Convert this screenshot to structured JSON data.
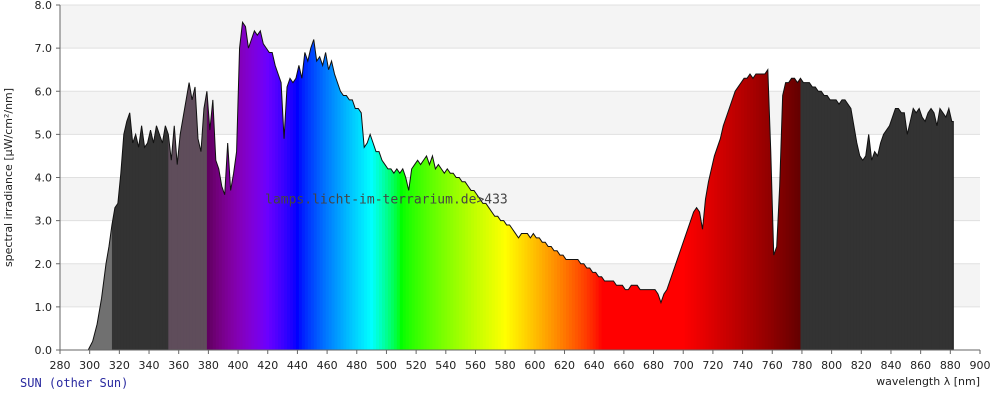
{
  "footer": {
    "lamp_label": "SUN (other Sun)"
  },
  "chart_data": {
    "type": "area",
    "title": "",
    "watermark": "lamps.licht-im-terrarium.de>433",
    "xlabel": "wavelength λ [nm]",
    "ylabel": "spectral irradiance [µW/cm²/nm]",
    "xlim": [
      280,
      900
    ],
    "ylim": [
      0,
      8
    ],
    "xticks": [
      280,
      300,
      320,
      340,
      360,
      380,
      400,
      420,
      440,
      460,
      480,
      500,
      520,
      540,
      560,
      580,
      600,
      620,
      640,
      660,
      680,
      700,
      720,
      740,
      760,
      780,
      800,
      820,
      840,
      860,
      880,
      900
    ],
    "yticks": [
      0,
      1,
      2,
      3,
      4,
      5,
      6,
      7,
      8
    ],
    "ytick_labels": [
      "0.0",
      "1.0",
      "2.0",
      "3.0",
      "4.0",
      "5.0",
      "6.0",
      "7.0",
      "8.0"
    ],
    "grid": "horizontal-bands",
    "points": [
      [
        299,
        0
      ],
      [
        302,
        0.2
      ],
      [
        305,
        0.6
      ],
      [
        308,
        1.2
      ],
      [
        311,
        2.0
      ],
      [
        313,
        2.4
      ],
      [
        315,
        2.9
      ],
      [
        317,
        3.3
      ],
      [
        319,
        3.4
      ],
      [
        321,
        4.1
      ],
      [
        323,
        5.0
      ],
      [
        325,
        5.3
      ],
      [
        327,
        5.5
      ],
      [
        329,
        4.8
      ],
      [
        331,
        5.0
      ],
      [
        333,
        4.7
      ],
      [
        335,
        5.2
      ],
      [
        337,
        4.7
      ],
      [
        339,
        4.8
      ],
      [
        341,
        5.1
      ],
      [
        343,
        4.8
      ],
      [
        345,
        5.2
      ],
      [
        347,
        5.0
      ],
      [
        349,
        4.8
      ],
      [
        351,
        5.2
      ],
      [
        353,
        5.0
      ],
      [
        355,
        4.4
      ],
      [
        357,
        5.2
      ],
      [
        359,
        4.3
      ],
      [
        361,
        5.0
      ],
      [
        363,
        5.4
      ],
      [
        365,
        5.8
      ],
      [
        367,
        6.2
      ],
      [
        369,
        5.8
      ],
      [
        371,
        6.1
      ],
      [
        373,
        4.9
      ],
      [
        375,
        4.6
      ],
      [
        377,
        5.6
      ],
      [
        379,
        6.0
      ],
      [
        381,
        5.1
      ],
      [
        383,
        5.8
      ],
      [
        385,
        4.4
      ],
      [
        387,
        4.2
      ],
      [
        389,
        3.8
      ],
      [
        391,
        3.6
      ],
      [
        393,
        4.8
      ],
      [
        395,
        3.7
      ],
      [
        397,
        4.1
      ],
      [
        399,
        4.6
      ],
      [
        401,
        7.0
      ],
      [
        403,
        7.6
      ],
      [
        405,
        7.5
      ],
      [
        407,
        7.0
      ],
      [
        409,
        7.2
      ],
      [
        411,
        7.4
      ],
      [
        413,
        7.3
      ],
      [
        415,
        7.4
      ],
      [
        417,
        7.1
      ],
      [
        419,
        7.0
      ],
      [
        421,
        6.9
      ],
      [
        423,
        6.9
      ],
      [
        425,
        6.6
      ],
      [
        427,
        6.4
      ],
      [
        429,
        6.2
      ],
      [
        431,
        4.9
      ],
      [
        433,
        6.1
      ],
      [
        435,
        6.3
      ],
      [
        437,
        6.2
      ],
      [
        439,
        6.3
      ],
      [
        441,
        6.6
      ],
      [
        443,
        6.3
      ],
      [
        445,
        6.9
      ],
      [
        447,
        6.7
      ],
      [
        449,
        7.0
      ],
      [
        451,
        7.2
      ],
      [
        453,
        6.7
      ],
      [
        455,
        6.8
      ],
      [
        457,
        6.6
      ],
      [
        459,
        6.9
      ],
      [
        461,
        6.5
      ],
      [
        463,
        6.7
      ],
      [
        465,
        6.4
      ],
      [
        467,
        6.2
      ],
      [
        469,
        6.0
      ],
      [
        471,
        5.9
      ],
      [
        473,
        5.9
      ],
      [
        475,
        5.8
      ],
      [
        477,
        5.8
      ],
      [
        479,
        5.6
      ],
      [
        481,
        5.6
      ],
      [
        483,
        5.5
      ],
      [
        485,
        4.7
      ],
      [
        487,
        4.8
      ],
      [
        489,
        5.0
      ],
      [
        491,
        4.8
      ],
      [
        493,
        4.6
      ],
      [
        495,
        4.6
      ],
      [
        497,
        4.4
      ],
      [
        499,
        4.3
      ],
      [
        501,
        4.2
      ],
      [
        503,
        4.2
      ],
      [
        505,
        4.1
      ],
      [
        507,
        4.2
      ],
      [
        509,
        4.1
      ],
      [
        511,
        4.2
      ],
      [
        513,
        4.0
      ],
      [
        515,
        3.7
      ],
      [
        517,
        4.2
      ],
      [
        519,
        4.3
      ],
      [
        521,
        4.4
      ],
      [
        523,
        4.3
      ],
      [
        525,
        4.4
      ],
      [
        527,
        4.5
      ],
      [
        529,
        4.3
      ],
      [
        531,
        4.5
      ],
      [
        533,
        4.2
      ],
      [
        535,
        4.3
      ],
      [
        537,
        4.2
      ],
      [
        539,
        4.1
      ],
      [
        541,
        4.2
      ],
      [
        543,
        4.1
      ],
      [
        545,
        4.1
      ],
      [
        547,
        4.0
      ],
      [
        549,
        4.0
      ],
      [
        551,
        3.9
      ],
      [
        553,
        3.9
      ],
      [
        555,
        3.8
      ],
      [
        557,
        3.7
      ],
      [
        559,
        3.7
      ],
      [
        561,
        3.6
      ],
      [
        563,
        3.5
      ],
      [
        565,
        3.4
      ],
      [
        567,
        3.4
      ],
      [
        569,
        3.3
      ],
      [
        571,
        3.2
      ],
      [
        573,
        3.1
      ],
      [
        575,
        3.1
      ],
      [
        577,
        3.0
      ],
      [
        579,
        3.0
      ],
      [
        581,
        2.9
      ],
      [
        583,
        2.9
      ],
      [
        585,
        2.8
      ],
      [
        587,
        2.7
      ],
      [
        589,
        2.6
      ],
      [
        591,
        2.7
      ],
      [
        593,
        2.7
      ],
      [
        595,
        2.7
      ],
      [
        597,
        2.6
      ],
      [
        599,
        2.7
      ],
      [
        601,
        2.6
      ],
      [
        603,
        2.6
      ],
      [
        605,
        2.5
      ],
      [
        607,
        2.5
      ],
      [
        609,
        2.4
      ],
      [
        611,
        2.4
      ],
      [
        613,
        2.3
      ],
      [
        615,
        2.3
      ],
      [
        617,
        2.2
      ],
      [
        619,
        2.2
      ],
      [
        621,
        2.1
      ],
      [
        623,
        2.1
      ],
      [
        625,
        2.1
      ],
      [
        627,
        2.1
      ],
      [
        629,
        2.1
      ],
      [
        631,
        2.0
      ],
      [
        633,
        2.0
      ],
      [
        635,
        1.9
      ],
      [
        637,
        1.9
      ],
      [
        639,
        1.8
      ],
      [
        641,
        1.8
      ],
      [
        643,
        1.7
      ],
      [
        645,
        1.7
      ],
      [
        647,
        1.6
      ],
      [
        649,
        1.6
      ],
      [
        651,
        1.6
      ],
      [
        653,
        1.6
      ],
      [
        655,
        1.5
      ],
      [
        657,
        1.5
      ],
      [
        659,
        1.5
      ],
      [
        661,
        1.4
      ],
      [
        663,
        1.4
      ],
      [
        665,
        1.5
      ],
      [
        667,
        1.5
      ],
      [
        669,
        1.5
      ],
      [
        671,
        1.4
      ],
      [
        673,
        1.4
      ],
      [
        675,
        1.4
      ],
      [
        677,
        1.4
      ],
      [
        679,
        1.4
      ],
      [
        681,
        1.4
      ],
      [
        683,
        1.3
      ],
      [
        685,
        1.1
      ],
      [
        687,
        1.3
      ],
      [
        689,
        1.4
      ],
      [
        691,
        1.6
      ],
      [
        693,
        1.8
      ],
      [
        695,
        2.0
      ],
      [
        697,
        2.2
      ],
      [
        699,
        2.4
      ],
      [
        701,
        2.6
      ],
      [
        703,
        2.8
      ],
      [
        705,
        3.0
      ],
      [
        707,
        3.2
      ],
      [
        709,
        3.3
      ],
      [
        711,
        3.2
      ],
      [
        713,
        2.8
      ],
      [
        715,
        3.5
      ],
      [
        717,
        3.9
      ],
      [
        719,
        4.2
      ],
      [
        721,
        4.5
      ],
      [
        723,
        4.7
      ],
      [
        725,
        4.9
      ],
      [
        727,
        5.2
      ],
      [
        729,
        5.4
      ],
      [
        731,
        5.6
      ],
      [
        733,
        5.8
      ],
      [
        735,
        6.0
      ],
      [
        737,
        6.1
      ],
      [
        739,
        6.2
      ],
      [
        741,
        6.3
      ],
      [
        743,
        6.3
      ],
      [
        745,
        6.4
      ],
      [
        747,
        6.3
      ],
      [
        749,
        6.4
      ],
      [
        751,
        6.4
      ],
      [
        753,
        6.4
      ],
      [
        755,
        6.4
      ],
      [
        757,
        6.5
      ],
      [
        759,
        4.6
      ],
      [
        761,
        2.2
      ],
      [
        763,
        2.4
      ],
      [
        765,
        3.8
      ],
      [
        767,
        5.9
      ],
      [
        769,
        6.2
      ],
      [
        771,
        6.2
      ],
      [
        773,
        6.3
      ],
      [
        775,
        6.3
      ],
      [
        777,
        6.2
      ],
      [
        779,
        6.3
      ],
      [
        781,
        6.2
      ],
      [
        783,
        6.2
      ],
      [
        785,
        6.2
      ],
      [
        787,
        6.1
      ],
      [
        789,
        6.1
      ],
      [
        791,
        6.0
      ],
      [
        793,
        6.0
      ],
      [
        795,
        5.9
      ],
      [
        797,
        5.9
      ],
      [
        799,
        5.8
      ],
      [
        801,
        5.8
      ],
      [
        803,
        5.8
      ],
      [
        805,
        5.7
      ],
      [
        807,
        5.8
      ],
      [
        809,
        5.8
      ],
      [
        811,
        5.7
      ],
      [
        813,
        5.6
      ],
      [
        815,
        5.2
      ],
      [
        817,
        4.8
      ],
      [
        819,
        4.5
      ],
      [
        821,
        4.4
      ],
      [
        823,
        4.5
      ],
      [
        825,
        5.0
      ],
      [
        827,
        4.4
      ],
      [
        829,
        4.6
      ],
      [
        831,
        4.5
      ],
      [
        833,
        4.8
      ],
      [
        835,
        5.0
      ],
      [
        837,
        5.1
      ],
      [
        839,
        5.2
      ],
      [
        841,
        5.4
      ],
      [
        843,
        5.6
      ],
      [
        845,
        5.6
      ],
      [
        847,
        5.5
      ],
      [
        849,
        5.5
      ],
      [
        851,
        5.0
      ],
      [
        853,
        5.3
      ],
      [
        855,
        5.6
      ],
      [
        857,
        5.5
      ],
      [
        859,
        5.6
      ],
      [
        861,
        5.4
      ],
      [
        863,
        5.3
      ],
      [
        865,
        5.5
      ],
      [
        867,
        5.6
      ],
      [
        869,
        5.5
      ],
      [
        871,
        5.2
      ],
      [
        873,
        5.6
      ],
      [
        875,
        5.5
      ],
      [
        877,
        5.4
      ],
      [
        879,
        5.6
      ],
      [
        881,
        5.3
      ],
      [
        882,
        5.3
      ],
      [
        882,
        0
      ]
    ]
  }
}
